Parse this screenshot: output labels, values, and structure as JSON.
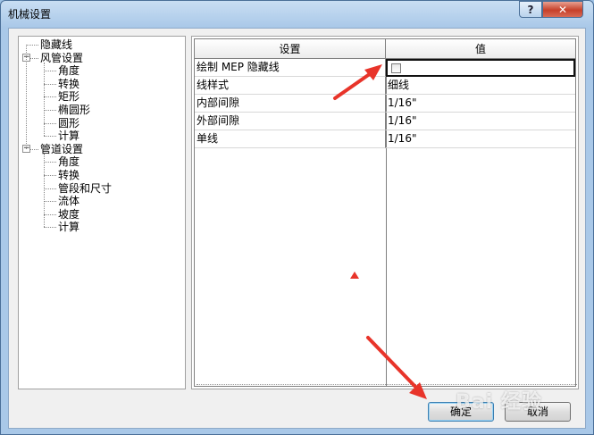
{
  "window": {
    "title": "机械设置",
    "help_label": "?",
    "close_label": "✕"
  },
  "tree": {
    "items": [
      {
        "label": "隐藏线",
        "level": 0
      },
      {
        "label": "风管设置",
        "level": 0,
        "expander": "−"
      },
      {
        "label": "角度",
        "level": 1
      },
      {
        "label": "转换",
        "level": 1
      },
      {
        "label": "矩形",
        "level": 1
      },
      {
        "label": "椭圆形",
        "level": 1
      },
      {
        "label": "圆形",
        "level": 1
      },
      {
        "label": "计算",
        "level": 1
      },
      {
        "label": "管道设置",
        "level": 0,
        "expander": "−"
      },
      {
        "label": "角度",
        "level": 1
      },
      {
        "label": "转换",
        "level": 1
      },
      {
        "label": "管段和尺寸",
        "level": 1
      },
      {
        "label": "流体",
        "level": 1
      },
      {
        "label": "坡度",
        "level": 1
      },
      {
        "label": "计算",
        "level": 1
      }
    ]
  },
  "table": {
    "headers": [
      "设置",
      "值"
    ],
    "rows": [
      {
        "setting": "绘制 MEP 隐藏线",
        "value": "",
        "checkbox": true,
        "checked": false
      },
      {
        "setting": "线样式",
        "value": "细线"
      },
      {
        "setting": "内部间隙",
        "value": "1/16\""
      },
      {
        "setting": "外部间隙",
        "value": "1/16\""
      },
      {
        "setting": "单线",
        "value": "1/16\""
      }
    ]
  },
  "buttons": {
    "ok": "确定",
    "cancel": "取消"
  },
  "colors": {
    "annotation_arrow": "#e8342a",
    "title_gradient": "#a9c8e8",
    "close_button": "#c6402a"
  },
  "watermark": "Bai 经验"
}
